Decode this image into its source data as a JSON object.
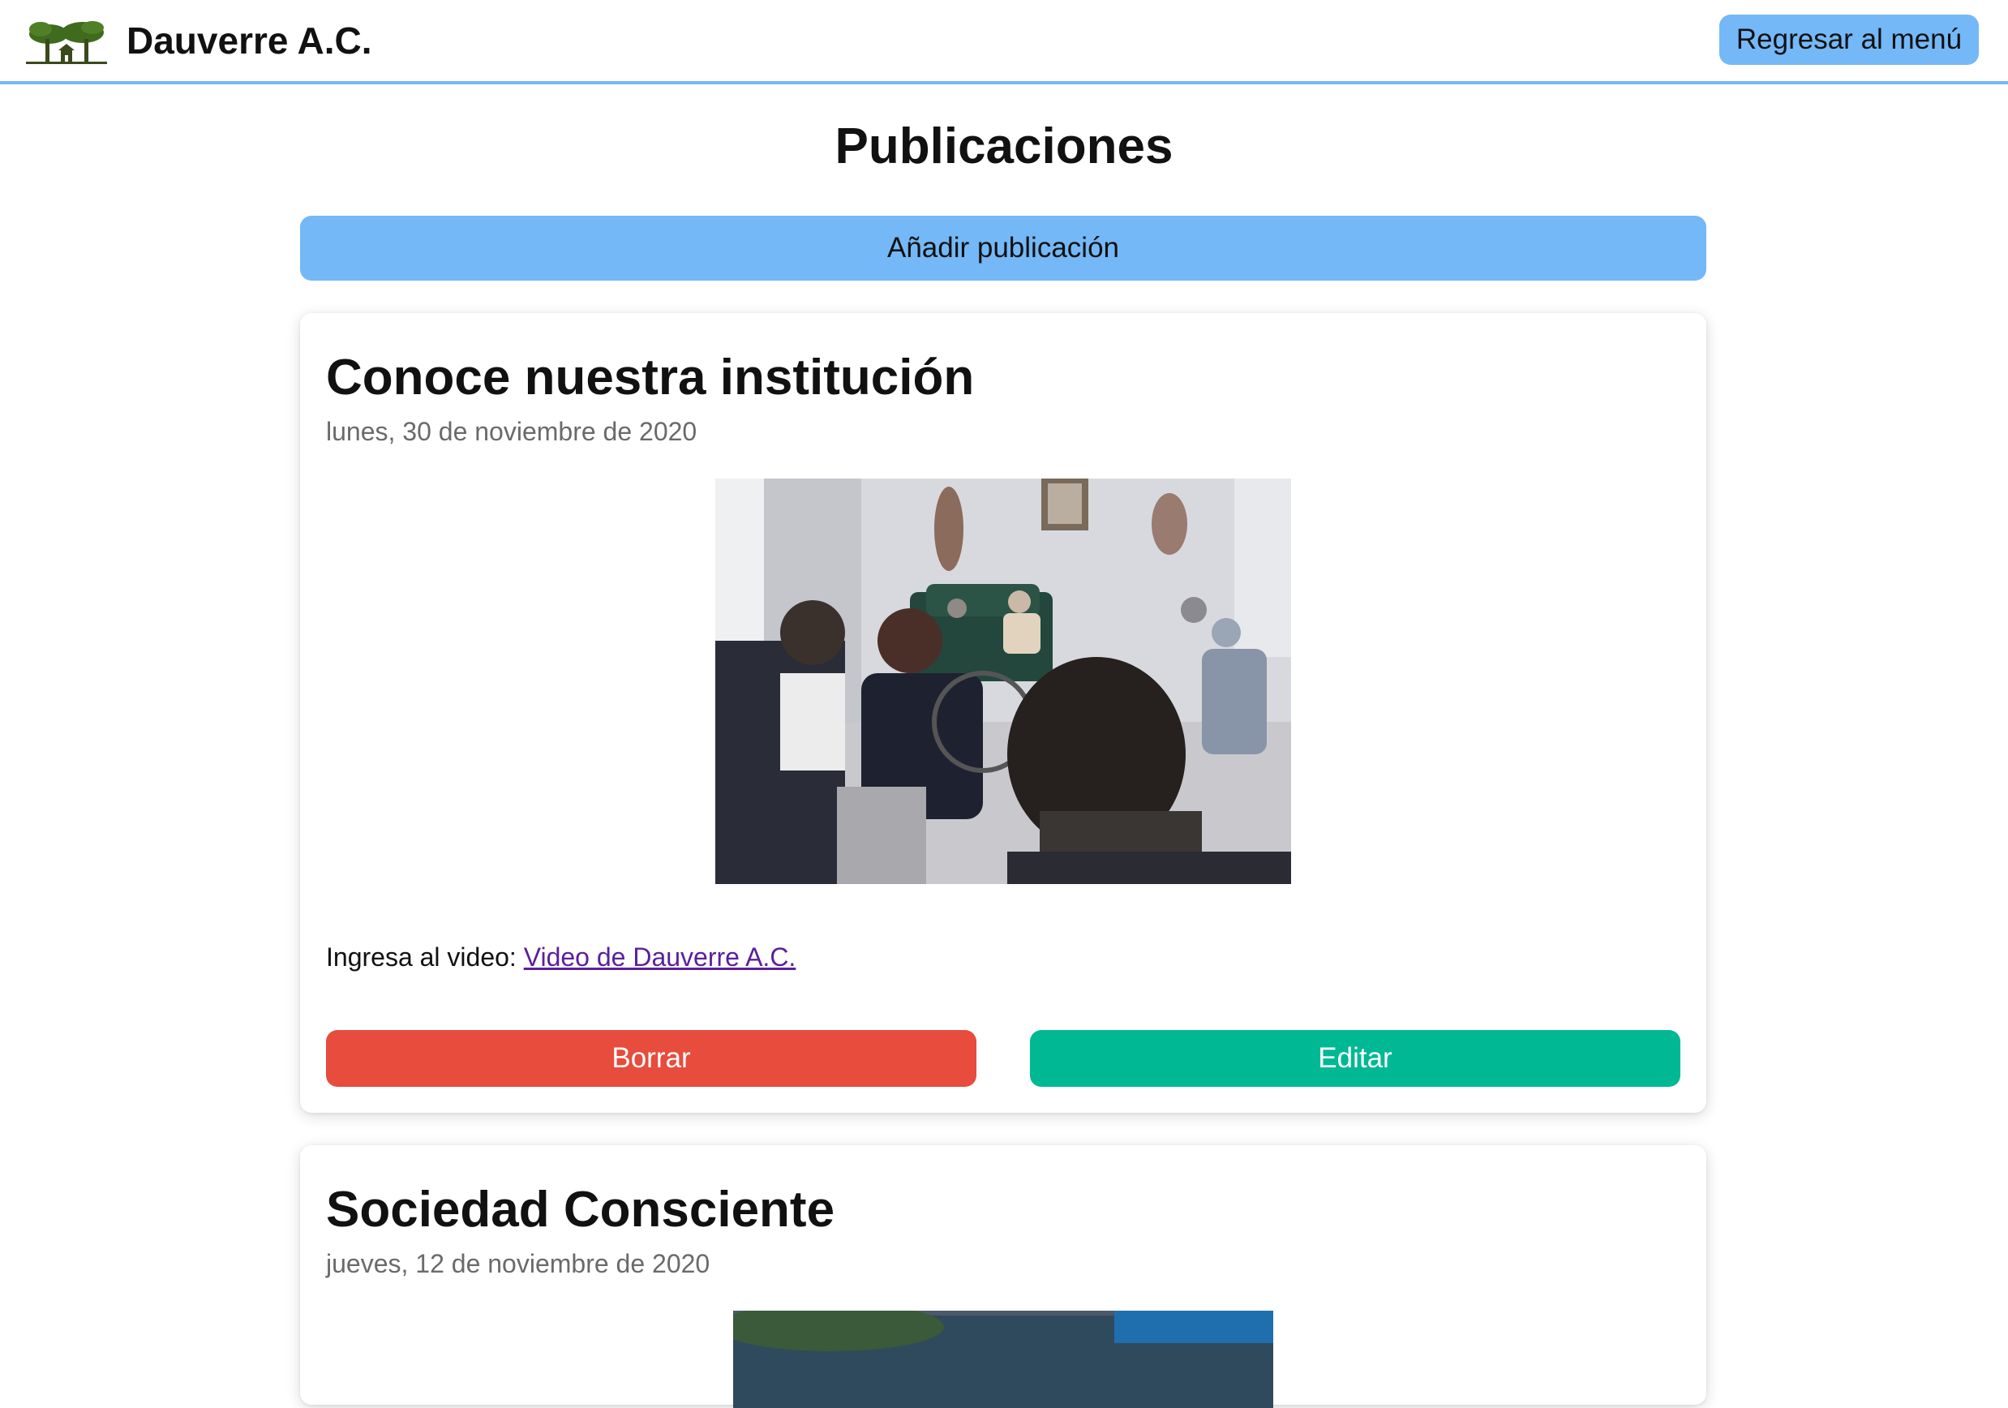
{
  "header": {
    "brand_name": "Dauverre A.C.",
    "logo_icon": "tree-house-logo",
    "back_button_label": "Regresar al menú"
  },
  "page": {
    "title": "Publicaciones",
    "add_button_label": "Añadir publicación"
  },
  "colors": {
    "accent": "#74b8f7",
    "delete": "#e74c3c",
    "edit": "#00b894",
    "link": "#5a1f9e"
  },
  "posts": [
    {
      "title": "Conoce nuestra institución",
      "date": "lunes, 30 de noviembre de 2020",
      "text_prefix": "Ingresa al video:",
      "link_text": "Video de Dauverre A.C.",
      "delete_label": "Borrar",
      "edit_label": "Editar"
    },
    {
      "title": "Sociedad Consciente",
      "date": "jueves, 12 de noviembre de 2020"
    }
  ]
}
